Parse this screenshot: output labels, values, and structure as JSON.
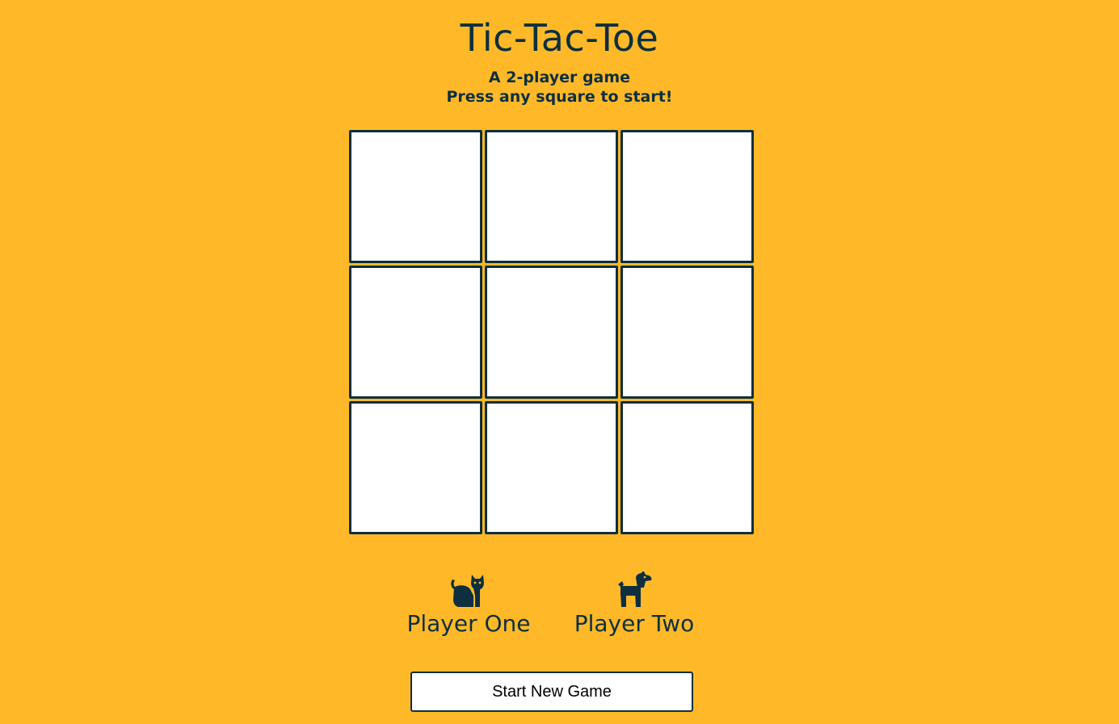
{
  "header": {
    "title": "Tic-Tac-Toe",
    "subtitle_line1": "A 2-player game",
    "subtitle_line2": "Press any square to start!"
  },
  "board": {
    "cells": [
      "",
      "",
      "",
      "",
      "",
      "",
      "",
      "",
      ""
    ]
  },
  "players": [
    {
      "name": "Player One",
      "icon": "cat-icon"
    },
    {
      "name": "Player Two",
      "icon": "dog-icon"
    }
  ],
  "controls": {
    "new_game_label": "Start New Game"
  },
  "colors": {
    "background": "#FFB928",
    "primary": "#0D2F3F",
    "cell": "#FFFFFF"
  }
}
